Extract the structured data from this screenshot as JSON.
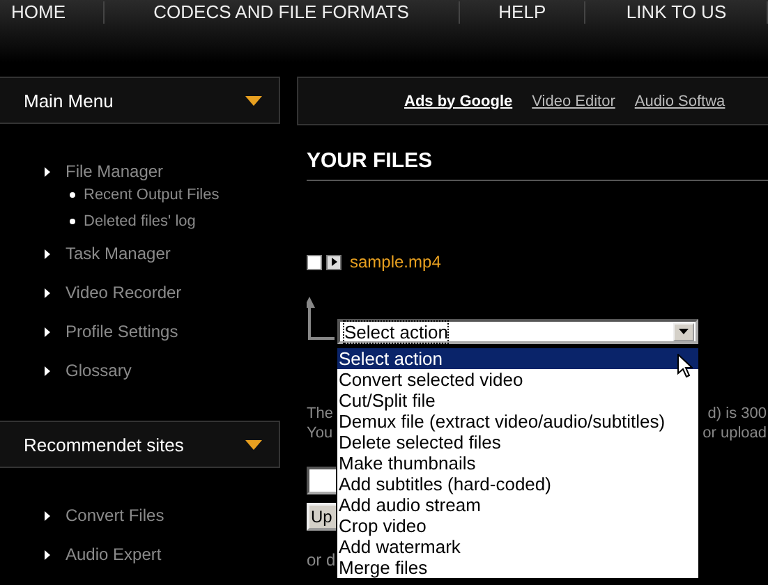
{
  "nav": [
    {
      "label": "HOME"
    },
    {
      "label": "CODECS AND FILE FORMATS"
    },
    {
      "label": "HELP"
    },
    {
      "label": "LINK TO US"
    }
  ],
  "sidebar": [
    {
      "title": "Main Menu",
      "items": [
        {
          "label": "File Manager",
          "children": [
            {
              "label": "Recent Output Files"
            },
            {
              "label": "Deleted files' log"
            }
          ]
        },
        {
          "label": "Task Manager"
        },
        {
          "label": "Video Recorder"
        },
        {
          "label": "Profile Settings"
        },
        {
          "label": "Glossary"
        }
      ]
    },
    {
      "title": "Recommendet sites",
      "items": [
        {
          "label": "Convert Files"
        },
        {
          "label": "Audio Expert"
        }
      ]
    }
  ],
  "ads": {
    "label": "Ads by Google",
    "links": [
      "Video Editor",
      "Audio Softwa"
    ]
  },
  "heading": "YOUR FILES",
  "files": [
    {
      "name": "sample.mp4",
      "checked": false
    }
  ],
  "action_select": {
    "value": "Select action",
    "expanded": true,
    "options": [
      {
        "label": "Select action",
        "selected": true
      },
      {
        "label": "Convert selected video",
        "selected": false
      },
      {
        "label": "Cut/Split file",
        "selected": false
      },
      {
        "label": "Demux file (extract video/audio/subtitles)",
        "selected": false
      },
      {
        "label": "Delete selected files",
        "selected": false
      },
      {
        "label": "Make thumbnails",
        "selected": false
      },
      {
        "label": "Add subtitles (hard-coded)",
        "selected": false
      },
      {
        "label": "Add audio stream",
        "selected": false
      },
      {
        "label": "Crop video",
        "selected": false
      },
      {
        "label": "Add watermark",
        "selected": false
      },
      {
        "label": "Merge files",
        "selected": false
      }
    ]
  },
  "info_lines": [
    {
      "left": "The",
      "right": "d) is 300"
    },
    {
      "left": "You",
      "right": "or upload"
    }
  ],
  "upload_button": "Up",
  "footer_text": "or d"
}
